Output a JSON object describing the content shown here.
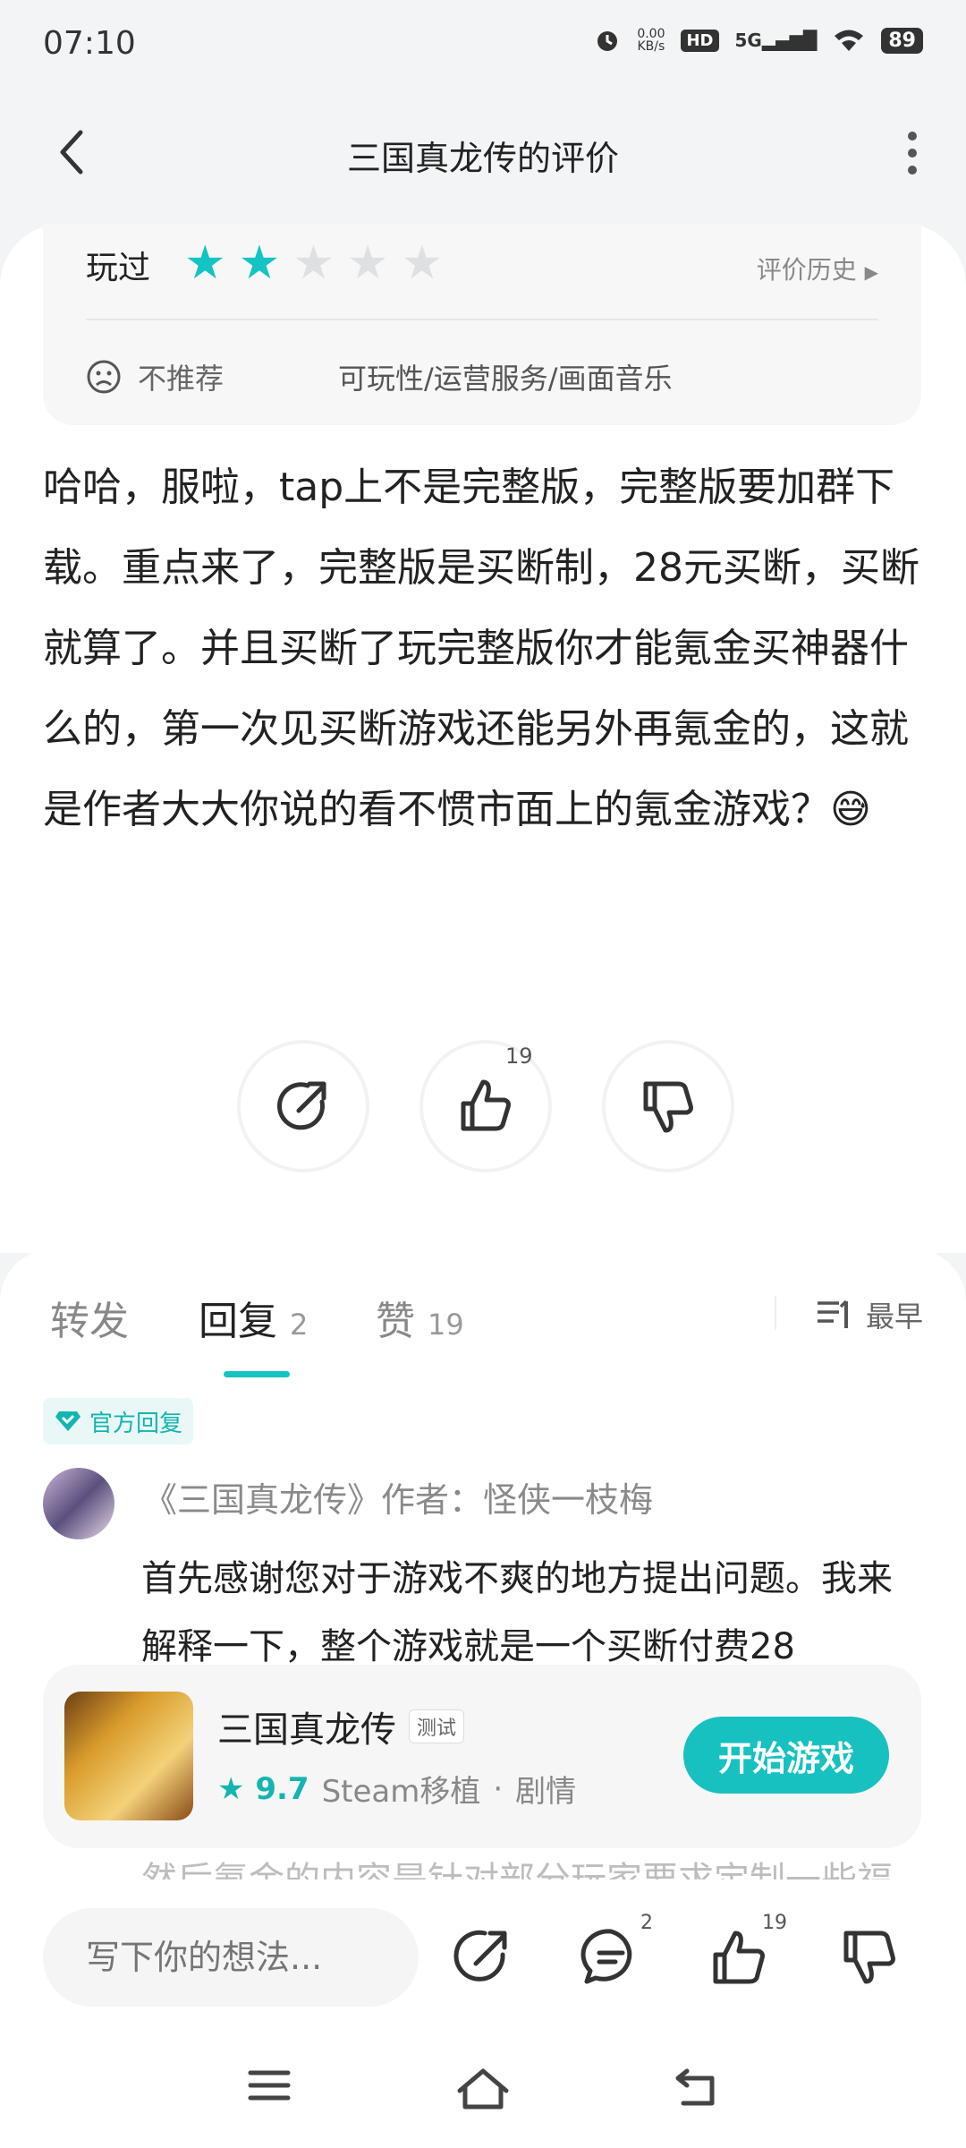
{
  "status_bar": {
    "time": "07:10",
    "net_speed": "0.00",
    "net_unit": "KB/s",
    "hd": "HD",
    "signal": "5G",
    "battery": "89"
  },
  "header": {
    "title": "三国真龙传的评价"
  },
  "rating": {
    "played_label": "玩过",
    "stars": 2,
    "max_stars": 5,
    "history_label": "评价历史",
    "recommend_label": "不推荐",
    "tags": "可玩性/运营服务/画面音乐"
  },
  "review": {
    "text": "哈哈，服啦，tap上不是完整版，完整版要加群下载。重点来了，完整版是买断制，28元买断，买断就算了。并且买断了玩完整版你才能氪金买神器什么的，第一次见买断游戏还能另外再氪金的，这就是作者大大你说的看不惯市面上的氪金游戏？😅"
  },
  "actions": {
    "like_count": "19"
  },
  "tabs": [
    {
      "label": "转发",
      "count": ""
    },
    {
      "label": "回复",
      "count": "2"
    },
    {
      "label": "赞",
      "count": "19"
    }
  ],
  "sort": {
    "label": "最早"
  },
  "official_reply": {
    "badge": "官方回复",
    "author": "《三国真龙传》作者：怪侠一枝梅",
    "text": "首先感谢您对于游戏不爽的地方提出问题。我来解释一下，整个游戏就是一个买断付费28",
    "peek_text": "然后氪金的内容是针对部分玩家要求定制一些福"
  },
  "game": {
    "name": "三国真龙传",
    "badge": "测试",
    "score": "9.7",
    "category1": "Steam移植",
    "separator": "·",
    "category2": "剧情",
    "play_button": "开始游戏"
  },
  "bottom_bar": {
    "input_placeholder": "写下你的想法...",
    "reply_count": "2",
    "like_count": "19"
  },
  "colors": {
    "accent": "#14c4c4",
    "star_off": "#dfe0e2"
  }
}
